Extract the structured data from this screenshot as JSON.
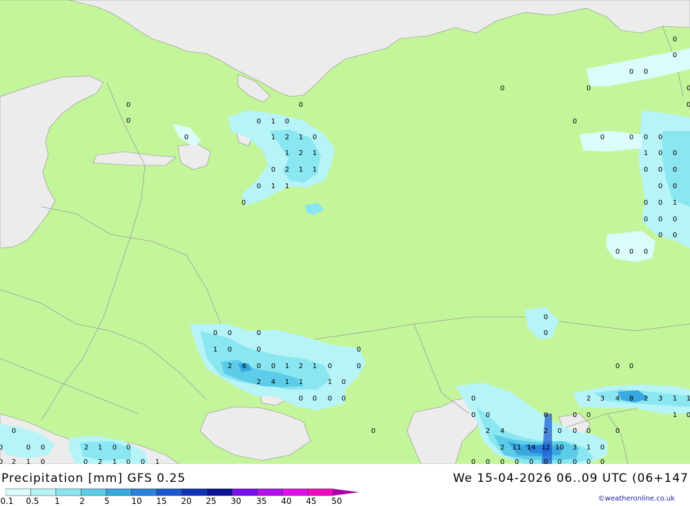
{
  "title": "Precipitation [mm]  GFS 0.25",
  "datetime": "We 15-04-2026 06..09 UTC (06+147",
  "credit": "©weatheronline.co.uk",
  "colors": {
    "land": "#c4f59b",
    "sea": "#ececec",
    "border": "#9a9a9a",
    "coast": "#888888"
  },
  "legend": {
    "labels": [
      "0.1",
      "0.5",
      "1",
      "2",
      "5",
      "10",
      "15",
      "20",
      "25",
      "30",
      "35",
      "40",
      "45",
      "50"
    ],
    "colors": [
      "#dcfcfc",
      "#b6f4f8",
      "#8ae6f0",
      "#5ccce8",
      "#3aa8e0",
      "#2a82dc",
      "#1c58d0",
      "#1034b8",
      "#0a1296",
      "#7a0ef0",
      "#b40ef0",
      "#e00ee8",
      "#f00ac0",
      "#a800a8"
    ]
  },
  "map_values": [
    {
      "t": "0"
    },
    {
      "t": "0"
    },
    {
      "t": "0"
    },
    {
      "t": "0"
    },
    {
      "t": "0"
    },
    {
      "t": "1"
    },
    {
      "t": "0"
    },
    {
      "t": "1"
    },
    {
      "t": "2"
    },
    {
      "t": "1"
    },
    {
      "t": "0"
    },
    {
      "t": "1"
    },
    {
      "t": "2"
    },
    {
      "t": "1"
    },
    {
      "t": "0"
    },
    {
      "t": "2"
    },
    {
      "t": "1"
    },
    {
      "t": "1"
    },
    {
      "t": "0"
    },
    {
      "t": "1"
    },
    {
      "t": "1"
    },
    {
      "t": "0"
    },
    {
      "t": "0"
    },
    {
      "t": "0"
    },
    {
      "t": "0"
    },
    {
      "t": "0"
    },
    {
      "t": "0"
    },
    {
      "t": "0"
    },
    {
      "t": "0"
    },
    {
      "t": "0"
    },
    {
      "t": "0"
    },
    {
      "t": "0"
    },
    {
      "t": "0"
    },
    {
      "t": "0"
    },
    {
      "t": "0"
    },
    {
      "t": "1"
    },
    {
      "t": "0"
    },
    {
      "t": "0"
    },
    {
      "t": "0"
    },
    {
      "t": "0"
    },
    {
      "t": "0"
    },
    {
      "t": "0"
    },
    {
      "t": "0"
    },
    {
      "t": "0"
    },
    {
      "t": "0"
    },
    {
      "t": "1"
    },
    {
      "t": "0"
    },
    {
      "t": "0"
    },
    {
      "t": "0"
    },
    {
      "t": "0"
    },
    {
      "t": "0"
    },
    {
      "t": "0"
    },
    {
      "t": "0"
    },
    {
      "t": "0"
    },
    {
      "t": "0"
    },
    {
      "t": "0"
    },
    {
      "t": "0"
    },
    {
      "t": "0"
    },
    {
      "t": "0"
    },
    {
      "t": "0"
    },
    {
      "t": "0"
    },
    {
      "t": "1"
    },
    {
      "t": "0"
    },
    {
      "t": "0"
    },
    {
      "t": "2"
    },
    {
      "t": "6"
    },
    {
      "t": "0"
    },
    {
      "t": "0"
    },
    {
      "t": "1"
    },
    {
      "t": "2"
    },
    {
      "t": "1"
    },
    {
      "t": "0"
    },
    {
      "t": "0"
    },
    {
      "t": "2"
    },
    {
      "t": "4"
    },
    {
      "t": "1"
    },
    {
      "t": "1"
    },
    {
      "t": "1"
    },
    {
      "t": "0"
    },
    {
      "t": "0"
    },
    {
      "t": "0"
    },
    {
      "t": "0"
    },
    {
      "t": "0"
    },
    {
      "t": "0"
    },
    {
      "t": "0"
    },
    {
      "t": "0"
    },
    {
      "t": "0"
    },
    {
      "t": "0"
    },
    {
      "t": "2"
    },
    {
      "t": "3"
    },
    {
      "t": "4"
    },
    {
      "t": "8"
    },
    {
      "t": "2"
    },
    {
      "t": "3"
    },
    {
      "t": "1"
    },
    {
      "t": "1"
    },
    {
      "t": "0"
    },
    {
      "t": "0"
    },
    {
      "t": "0"
    },
    {
      "t": "1"
    },
    {
      "t": "0"
    },
    {
      "t": "0"
    },
    {
      "t": "0"
    },
    {
      "t": "0"
    },
    {
      "t": "2"
    },
    {
      "t": "4"
    },
    {
      "t": "2"
    },
    {
      "t": "0"
    },
    {
      "t": "0"
    },
    {
      "t": "0"
    },
    {
      "t": "0"
    },
    {
      "t": "2"
    },
    {
      "t": "11"
    },
    {
      "t": "14"
    },
    {
      "t": "12"
    },
    {
      "t": "10"
    },
    {
      "t": "3"
    },
    {
      "t": "1"
    },
    {
      "t": "0"
    },
    {
      "t": "0"
    },
    {
      "t": "0"
    },
    {
      "t": "0"
    },
    {
      "t": "0"
    },
    {
      "t": "2"
    },
    {
      "t": "1"
    },
    {
      "t": "0"
    },
    {
      "t": "0"
    },
    {
      "t": "0"
    },
    {
      "t": "2"
    },
    {
      "t": "1"
    },
    {
      "t": "0"
    },
    {
      "t": "0"
    },
    {
      "t": "0"
    },
    {
      "t": "1"
    },
    {
      "t": "0"
    },
    {
      "t": "0"
    },
    {
      "t": "0"
    },
    {
      "t": "0"
    },
    {
      "t": "0"
    },
    {
      "t": "2"
    },
    {
      "t": "1"
    },
    {
      "t": "0"
    },
    {
      "t": "0"
    },
    {
      "t": "0"
    }
  ]
}
